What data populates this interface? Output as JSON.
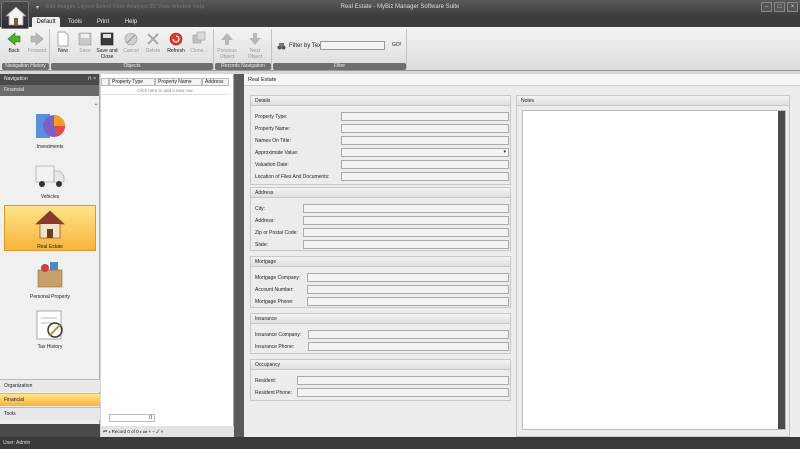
{
  "window": {
    "title": "Real Estate - MyBiz Manager Software Suite",
    "dim_menu": "Edit   Images   Layout   Select   Files   Analysis   3D   View   Window   Help"
  },
  "tabs": [
    "Default",
    "Tools",
    "Print",
    "Help"
  ],
  "ribbon": {
    "groups": [
      "Navigation History",
      "Objects",
      "Records Navigation",
      "Filter"
    ],
    "buttons": {
      "back": "Back",
      "forward": "Forward",
      "new": "New",
      "save": "Save",
      "save_close": "Save and Close",
      "cancel": "Cancel",
      "delete": "Delete",
      "refresh": "Refresh",
      "clone": "Clone...",
      "previous": "Previous Object",
      "next": "Next Object"
    },
    "filter_label": "Filter by Text",
    "filter_go": "GO!"
  },
  "nav": {
    "header": "Navigation",
    "current": "Financial",
    "items": [
      "Investments",
      "Vehicles",
      "Real Estate",
      "Personal Property",
      "Tax History"
    ],
    "bottom": [
      "Organization",
      "Financial",
      "Tools"
    ]
  },
  "grid": {
    "columns": [
      "Property Type",
      "Property Name",
      "Address"
    ],
    "add_row": "Click here to add a new row",
    "count": "0",
    "record_nav": "Record 0 of 0"
  },
  "main": {
    "title": "Real Estate",
    "notes_label": "Notes",
    "sections": [
      {
        "title": "Details",
        "fields": [
          "Property Type:",
          "Property Name:",
          "Names On Title:",
          "Approximate Value:",
          "Valuation Date:",
          "Location of Files And Documents:"
        ]
      },
      {
        "title": "Address",
        "fields": [
          "City:",
          "Address:",
          "Zip or Postal Code:",
          "State:"
        ]
      },
      {
        "title": "Mortgage",
        "fields": [
          "Mortgage Company:",
          "Account Number:",
          "Mortgage Phone:"
        ]
      },
      {
        "title": "Insurance",
        "fields": [
          "Insurance Company:",
          "Insurance Phone:"
        ]
      },
      {
        "title": "Occupancy",
        "fields": [
          "Resident:",
          "Resident Phone:"
        ]
      }
    ]
  },
  "status": {
    "user": "User: Admin"
  }
}
